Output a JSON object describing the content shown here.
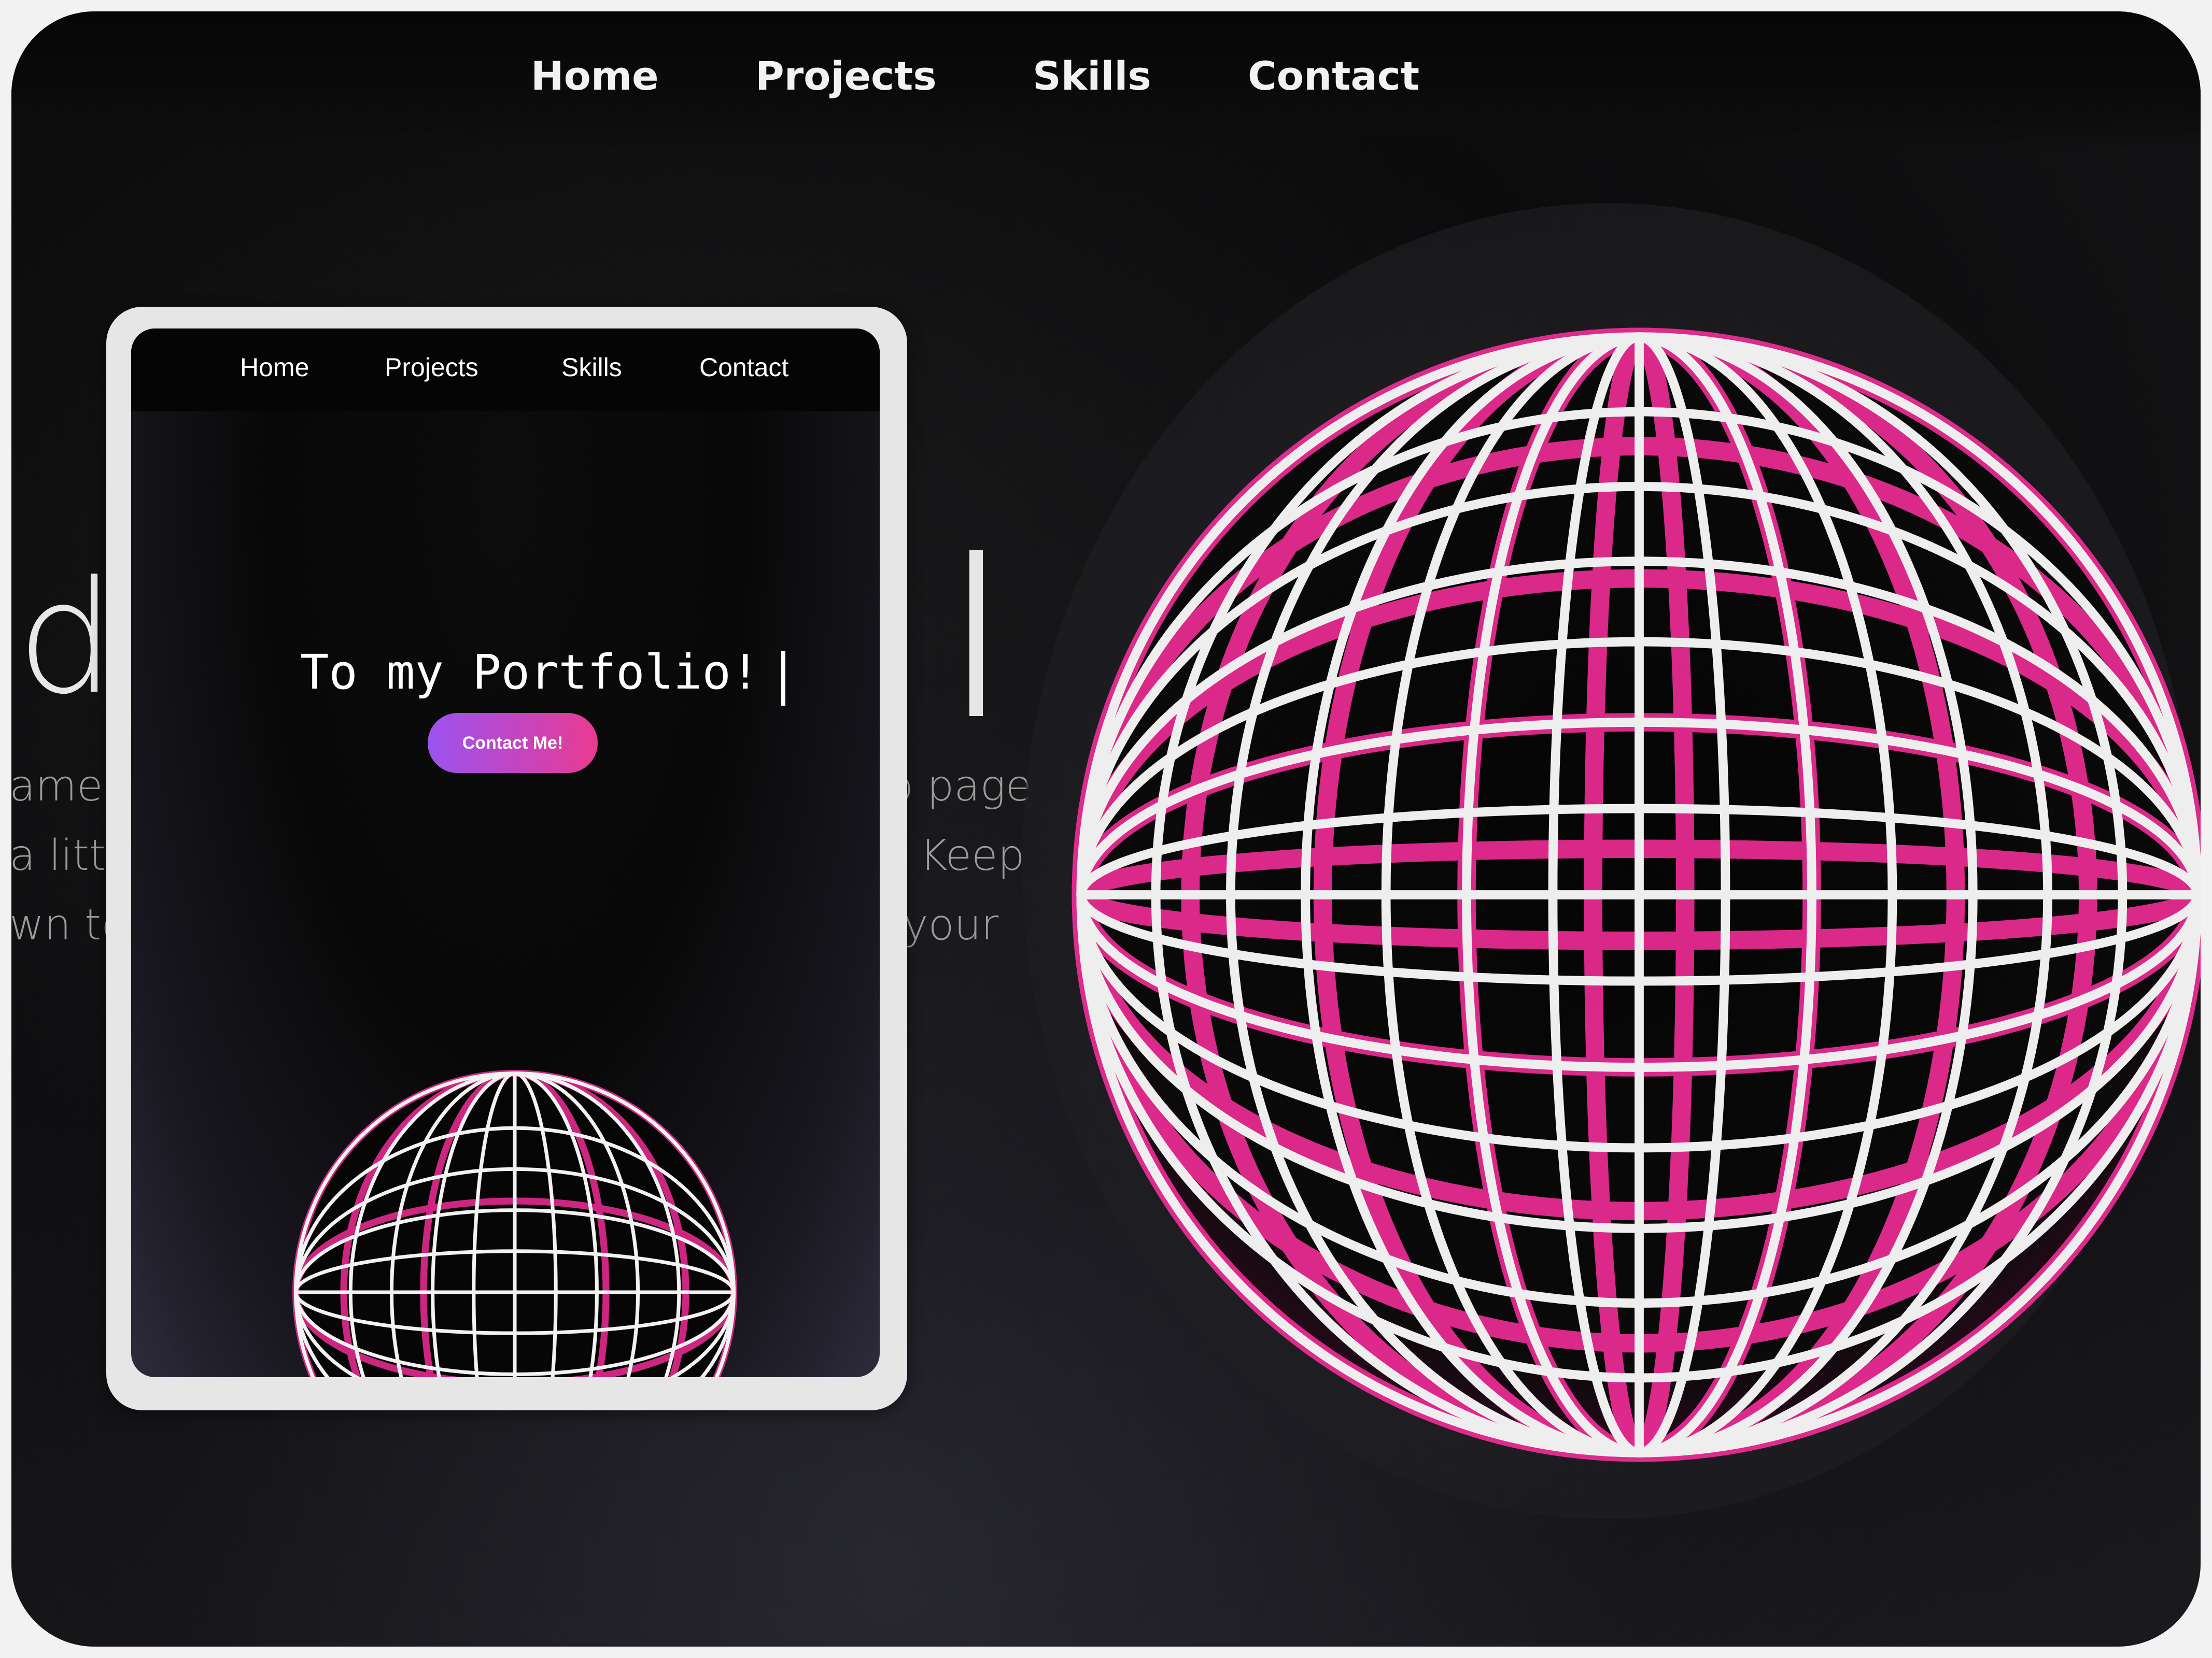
{
  "desktop": {
    "nav": [
      "Home",
      "Projects",
      "Skills",
      "Contact"
    ],
    "heading_fragment": "d",
    "paragraph_fragments": {
      "left": [
        "ame",
        "a little",
        "wn to"
      ],
      "right": [
        "o page",
        "Keep",
        "your"
      ]
    }
  },
  "tablet": {
    "nav": [
      "Home",
      "Projects",
      "Skills",
      "Contact"
    ],
    "heading": "To my Portfolio!",
    "contact_button": "Contact Me!"
  },
  "colors": {
    "background": "#0b0b0c",
    "globe_wire": "#f0f0f0",
    "globe_glow": "#ff2fa0",
    "button_start": "#9b54f0",
    "button_end": "#e83c8f",
    "tablet_bezel": "#e6e6e6"
  },
  "icons": {
    "desktop_globe": "wireframe-globe-icon",
    "tablet_globe": "wireframe-globe-icon"
  }
}
